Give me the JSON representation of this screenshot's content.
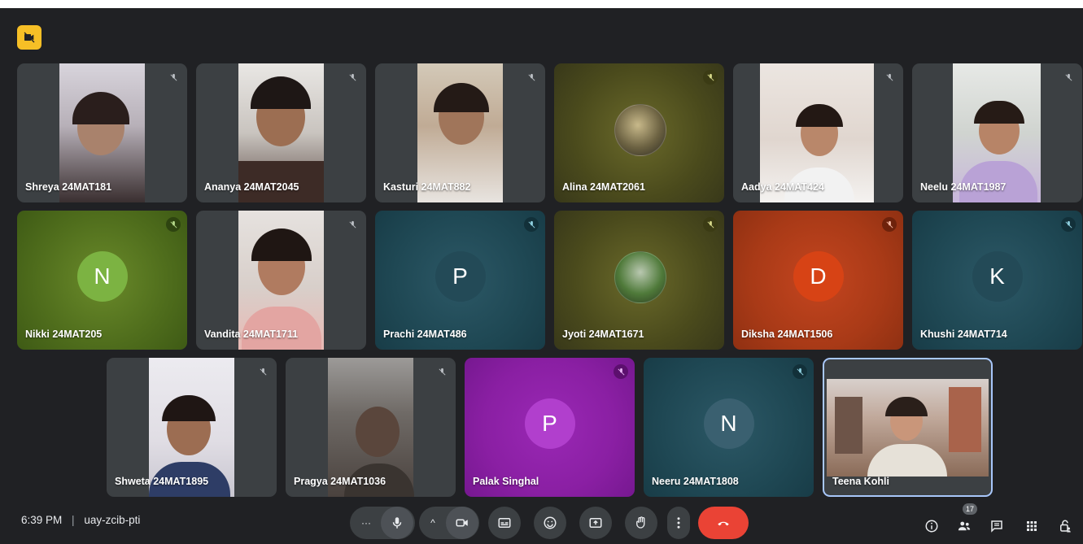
{
  "meeting": {
    "time": "6:39 PM",
    "separator": "|",
    "code": "uay-zcib-pti",
    "people_count": "17"
  },
  "participants": [
    {
      "name": "Shreya 24MAT181",
      "type": "video"
    },
    {
      "name": "Ananya 24MAT2045",
      "type": "video"
    },
    {
      "name": "Kasturi 24MAT882",
      "type": "video"
    },
    {
      "name": "Alina 24MAT2061",
      "type": "photo"
    },
    {
      "name": "Aadya 24MAT424",
      "type": "video"
    },
    {
      "name": "Neelu 24MAT1987",
      "type": "video"
    },
    {
      "name": "Nikki 24MAT205",
      "type": "letter",
      "initial": "N"
    },
    {
      "name": "Vandita 24MAT1711",
      "type": "video"
    },
    {
      "name": "Prachi 24MAT486",
      "type": "letter",
      "initial": "P"
    },
    {
      "name": "Jyoti 24MAT1671",
      "type": "photo"
    },
    {
      "name": "Diksha 24MAT1506",
      "type": "letter",
      "initial": "D"
    },
    {
      "name": "Khushi 24MAT714",
      "type": "letter",
      "initial": "K"
    },
    {
      "name": "Shweta 24MAT1895",
      "type": "video"
    },
    {
      "name": "Pragya 24MAT1036",
      "type": "video"
    },
    {
      "name": "Palak Singhal",
      "type": "letter",
      "initial": "P"
    },
    {
      "name": "Neeru 24MAT1808",
      "type": "letter",
      "initial": "N"
    },
    {
      "name": "Teena Kohli",
      "type": "video-self"
    }
  ],
  "controls": {
    "more_label": "···",
    "caret_label": "^"
  },
  "colors": {
    "background": "#202124",
    "end_call": "#ea4335",
    "badge_yellow": "#f6bf26",
    "green_tile": "#5a7a1f",
    "teal_tile": "#1e4b57",
    "purple_tile": "#8b1fa3",
    "orange_tile": "#b43a18",
    "olive_tile": "#50521c"
  }
}
